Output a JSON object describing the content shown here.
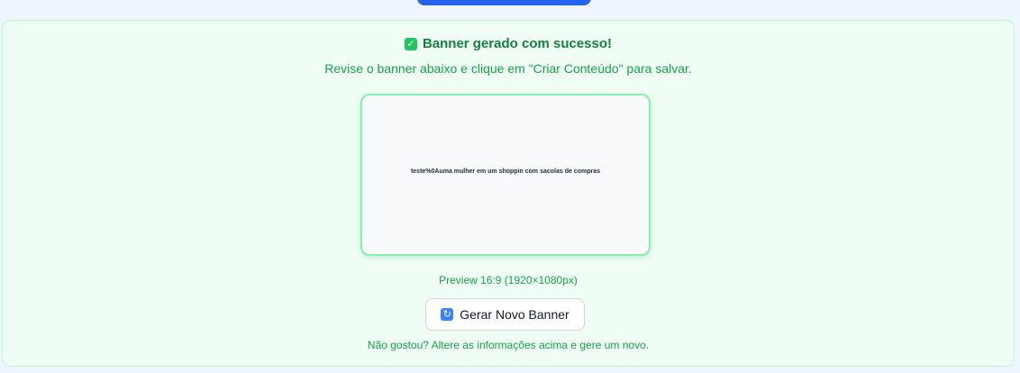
{
  "success": {
    "icon": "check-icon",
    "title": "Banner gerado com sucesso!",
    "subtitle": "Revise o banner abaixo e clique em \"Criar Conteúdo\" para salvar."
  },
  "preview": {
    "text": "teste%0Auma mulher em um shoppin com sacolas de compras",
    "caption": "Preview 16:9 (1920×1080px)"
  },
  "actions": {
    "regenerate_icon": "refresh-icon",
    "regenerate_label": "Gerar Novo Banner"
  },
  "hint": "Não gostou? Altere as informações acima e gere um novo.",
  "colors": {
    "accent": "#16a34a",
    "panel_bg": "#f0fdf4",
    "panel_border": "#bbf7d0",
    "top_button": "#2563eb"
  }
}
